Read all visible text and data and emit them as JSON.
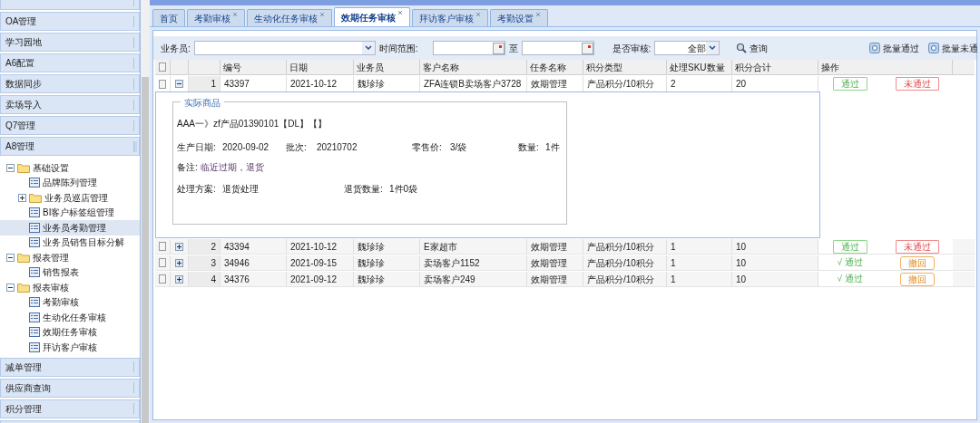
{
  "sidebar": {
    "sections": [
      {
        "expanded": false
      },
      {
        "label": "OA管理",
        "expanded": false
      },
      {
        "label": "学习园地",
        "expanded": false
      },
      {
        "label": "A6配置",
        "expanded": false
      },
      {
        "label": "数据同步",
        "expanded": false
      },
      {
        "label": "卖场导入",
        "expanded": false
      },
      {
        "label": "Q7管理",
        "expanded": false
      },
      {
        "label": "A8管理",
        "expanded": true,
        "tree": [
          {
            "label": "基础设置",
            "kind": "folder",
            "expanded": true,
            "children": [
              {
                "label": "品牌陈列管理",
                "kind": "page",
                "selected": false
              },
              {
                "label": "业务员巡店管理",
                "kind": "folder",
                "expanded": false
              },
              {
                "label": "BI客户标签组管理",
                "kind": "page",
                "selected": false
              },
              {
                "label": "业务员考勤管理",
                "kind": "page",
                "selected": true
              },
              {
                "label": "业务员销售目标分解",
                "kind": "page",
                "selected": false
              }
            ]
          },
          {
            "label": "报表管理",
            "kind": "folder",
            "expanded": true,
            "children": [
              {
                "label": "销售报表",
                "kind": "page",
                "selected": false
              }
            ]
          },
          {
            "label": "报表审核",
            "kind": "folder",
            "expanded": true,
            "children": [
              {
                "label": "考勤审核",
                "kind": "page",
                "selected": false
              },
              {
                "label": "生动化任务审核",
                "kind": "page",
                "selected": false
              },
              {
                "label": "效期任务审核",
                "kind": "page",
                "selected": false
              },
              {
                "label": "拜访客户审核",
                "kind": "page",
                "selected": false
              }
            ]
          }
        ]
      },
      {
        "label": "减单管理",
        "expanded": false
      },
      {
        "label": "供应商查询",
        "expanded": false
      },
      {
        "label": "积分管理",
        "expanded": false
      },
      {
        "expanded": false
      }
    ]
  },
  "tabs": [
    {
      "label": "首页",
      "selected": false,
      "closable": false
    },
    {
      "label": "考勤审核",
      "selected": false,
      "closable": true
    },
    {
      "label": "生动化任务审核",
      "selected": false,
      "closable": true
    },
    {
      "label": "效期任务审核",
      "selected": true,
      "closable": true
    },
    {
      "label": "拜访客户审核",
      "selected": false,
      "closable": true
    },
    {
      "label": "考勤设置",
      "selected": false,
      "closable": true
    }
  ],
  "filters": {
    "salesman_label": "业务员:",
    "time_label": "时间范围:",
    "to_label": "至",
    "audit_label": "是否审核:",
    "audit_value": "全部",
    "search_button": "查询",
    "batch_pass": "批量通过",
    "batch_reject": "批量未通"
  },
  "table": {
    "all_checked": false,
    "columns": [
      "编号",
      "日期",
      "业务员",
      "客户名称",
      "任务名称",
      "积分类型",
      "处理SKU数量",
      "积分合计",
      "操作"
    ],
    "rows": [
      {
        "index": "1",
        "checked": false,
        "expanded": true,
        "cells": [
          "43397",
          "2021-10-12",
          "魏珍珍",
          "ZFA连锁B卖场客户3728",
          "效期管理",
          "产品积分/10积分",
          "2",
          "20"
        ],
        "actions": [
          {
            "kind": "approve",
            "label": "通过"
          },
          {
            "kind": "reject",
            "label": "未通过"
          }
        ],
        "detail": {
          "legend": "实际商品",
          "product": "AAA一》zf产品01390101【DL】【】",
          "fields": [
            {
              "label": "生产日期:",
              "value": "2020-09-02"
            },
            {
              "label": "批次:",
              "value": "20210702"
            },
            {
              "label": "零售价:",
              "value": "3/袋"
            },
            {
              "label": "数量:",
              "value": "1件"
            }
          ],
          "note_label": "备注:",
          "note": "临近过期，退货",
          "plan_label": "处理方案:",
          "plan": "退货处理",
          "return_label": "退货数量:",
          "return_qty": "1件0袋"
        }
      },
      {
        "index": "2",
        "checked": false,
        "expanded": false,
        "cells": [
          "43394",
          "2021-10-12",
          "魏珍珍",
          "E家超市",
          "效期管理",
          "产品积分/10积分",
          "1",
          "10"
        ],
        "actions": [
          {
            "kind": "approve",
            "label": "通过"
          },
          {
            "kind": "reject",
            "label": "未通过"
          }
        ]
      },
      {
        "index": "3",
        "checked": false,
        "expanded": false,
        "cells": [
          "34946",
          "2021-09-15",
          "魏珍珍",
          "卖场客户1152",
          "效期管理",
          "产品积分/10积分",
          "1",
          "10"
        ],
        "actions": [
          {
            "kind": "approved",
            "label": "√ 通过"
          },
          {
            "kind": "revoke",
            "label": "撤回"
          }
        ]
      },
      {
        "index": "4",
        "checked": false,
        "expanded": false,
        "cells": [
          "34376",
          "2021-09-12",
          "魏珍珍",
          "卖场客户249",
          "效期管理",
          "产品积分/10积分",
          "1",
          "10"
        ],
        "actions": [
          {
            "kind": "approved",
            "label": "√ 通过"
          },
          {
            "kind": "revoke",
            "label": "撤回"
          }
        ]
      }
    ]
  }
}
